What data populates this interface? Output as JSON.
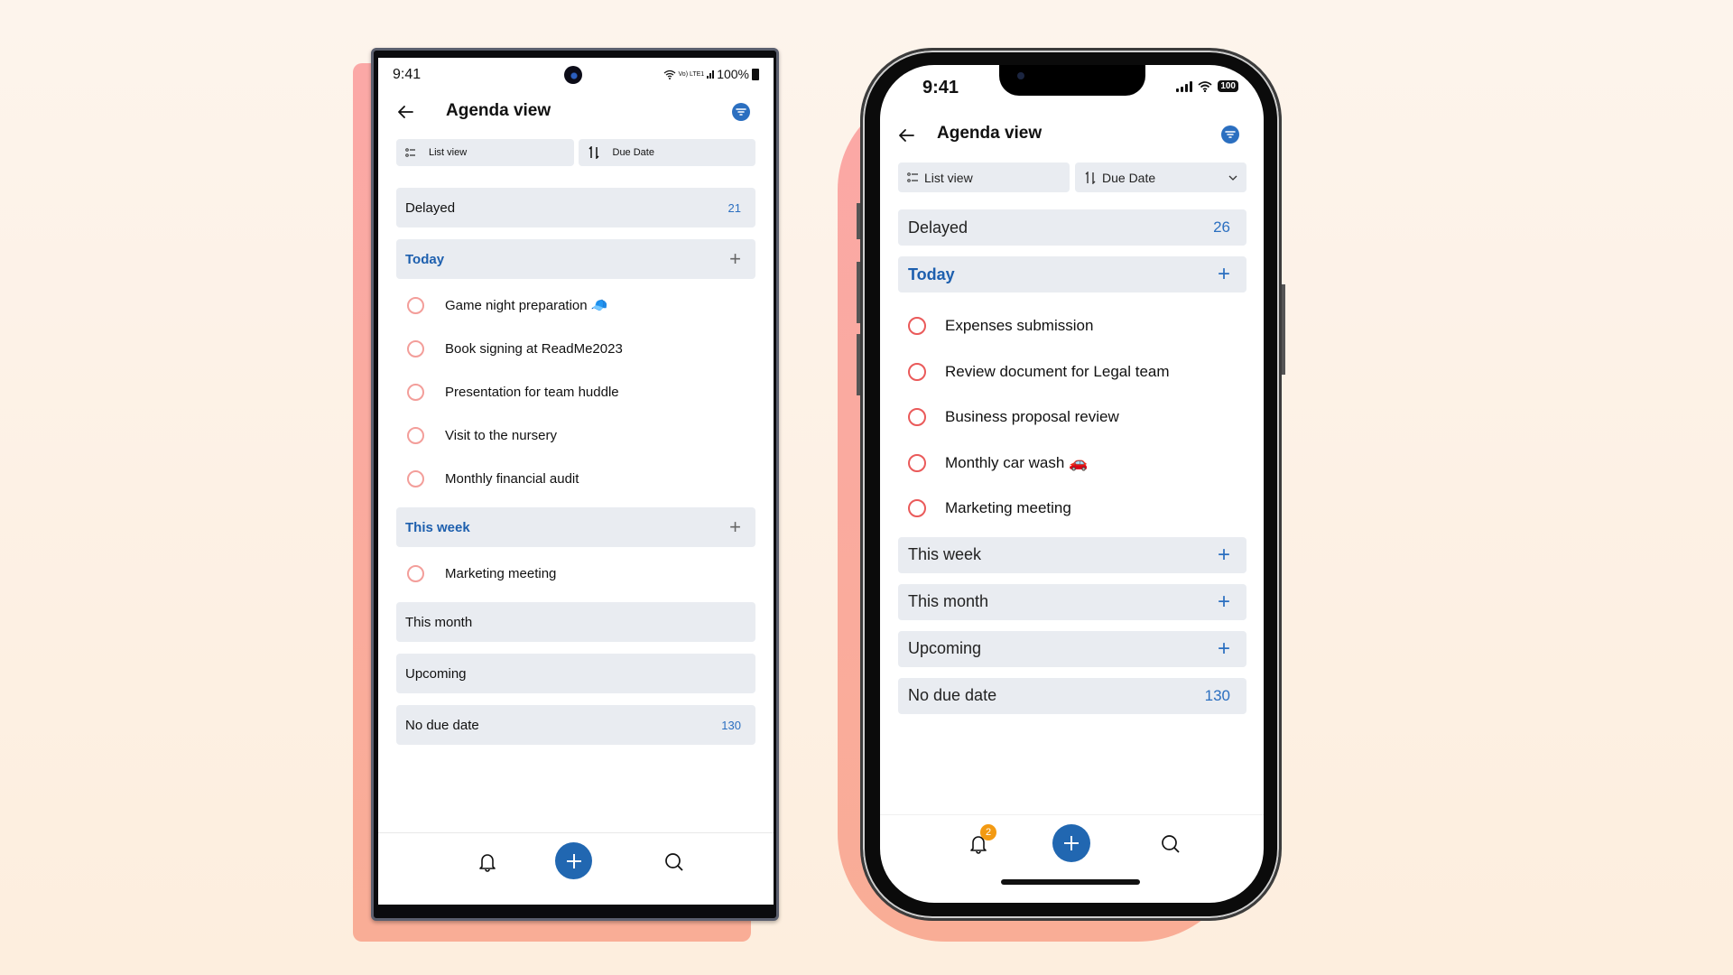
{
  "theme": {
    "accent": "#2167b1",
    "section_bg": "#e9ecf1",
    "task_circle_android": "#f39e9a",
    "task_circle_ios": "#ea5a5a",
    "badge": "#f39a12",
    "backdrop": "#fdf4ec"
  },
  "android": {
    "status": {
      "time": "9:41",
      "network": "Vo) LTE1",
      "battery": "100%"
    },
    "header": {
      "title": "Agenda view",
      "back_icon": "arrow-left-icon",
      "filter_icon": "filter-icon"
    },
    "toolbar": {
      "view_label": "List view",
      "sort_label": "Due Date"
    },
    "sections": [
      {
        "label": "Delayed",
        "count": "21",
        "active": false
      },
      {
        "label": "Today",
        "active": true,
        "tasks": [
          "Game night preparation 🧢",
          "Book signing at ReadMe2023",
          "Presentation for team huddle",
          "Visit to the nursery",
          "Monthly financial audit"
        ]
      },
      {
        "label": "This week",
        "active": true,
        "tasks": [
          "Marketing meeting"
        ]
      },
      {
        "label": "This month",
        "active": false
      },
      {
        "label": "Upcoming",
        "active": false
      },
      {
        "label": "No due date",
        "count": "130",
        "active": false
      }
    ],
    "bottom_nav": {
      "left": "bell-icon",
      "center": "add-icon",
      "right": "search-icon"
    }
  },
  "ios": {
    "status": {
      "time": "9:41",
      "battery": "100"
    },
    "header": {
      "title": "Agenda view",
      "back_icon": "arrow-left-icon",
      "filter_icon": "filter-icon"
    },
    "toolbar": {
      "view_label": "List view",
      "sort_label": "Due Date"
    },
    "sections": [
      {
        "label": "Delayed",
        "count": "26",
        "active": false
      },
      {
        "label": "Today",
        "active": true,
        "tasks": [
          "Expenses submission",
          "Review document for Legal team",
          "Business proposal review",
          "Monthly car wash 🚗",
          "Marketing meeting"
        ]
      },
      {
        "label": "This week",
        "active": false
      },
      {
        "label": "This month",
        "active": false
      },
      {
        "label": "Upcoming",
        "active": false
      },
      {
        "label": "No due date",
        "count": "130",
        "active": false
      }
    ],
    "bottom_nav": {
      "left": "bell-icon",
      "badge": "2",
      "center": "add-icon",
      "right": "search-icon"
    }
  }
}
